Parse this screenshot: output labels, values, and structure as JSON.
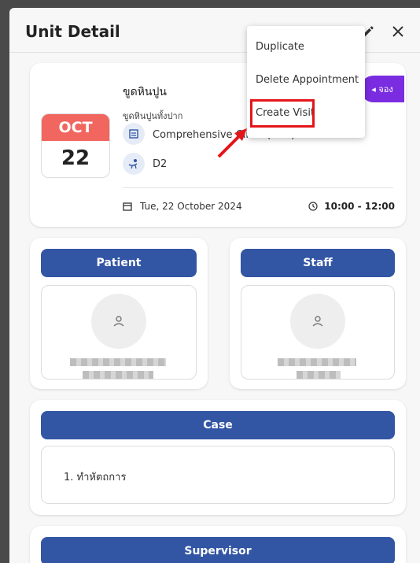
{
  "header": {
    "title": "Unit Detail"
  },
  "appointment": {
    "month": "OCT",
    "day": "22",
    "title": "ขูดหินปูน",
    "subtitle": "ขูดหินปูนทั้งปาก",
    "clinic": "Comprehensive Clinic (ชั้น2)",
    "chair": "D2",
    "date": "Tue, 22 October 2024",
    "time": "10:00 - 12:00",
    "book_label": "◂ จอง"
  },
  "patient": {
    "heading": "Patient"
  },
  "staff": {
    "heading": "Staff"
  },
  "case": {
    "heading": "Case",
    "items": [
      "1. ทำหัตถการ"
    ]
  },
  "supervisor": {
    "heading": "Supervisor"
  },
  "menu": {
    "items": [
      "Duplicate",
      "Delete Appointment",
      "Create Visit"
    ]
  },
  "colors": {
    "accent_blue": "#3255a4",
    "month_red": "#f1665f",
    "book_purple": "#7a2ce0",
    "highlight_red": "#e3151a"
  },
  "icons": {
    "edit": "pencil-icon",
    "close": "close-icon",
    "clinic": "building-icon",
    "chair": "dental-chair-icon",
    "calendar": "calendar-icon",
    "clock": "clock-icon",
    "avatar": "person-icon"
  }
}
